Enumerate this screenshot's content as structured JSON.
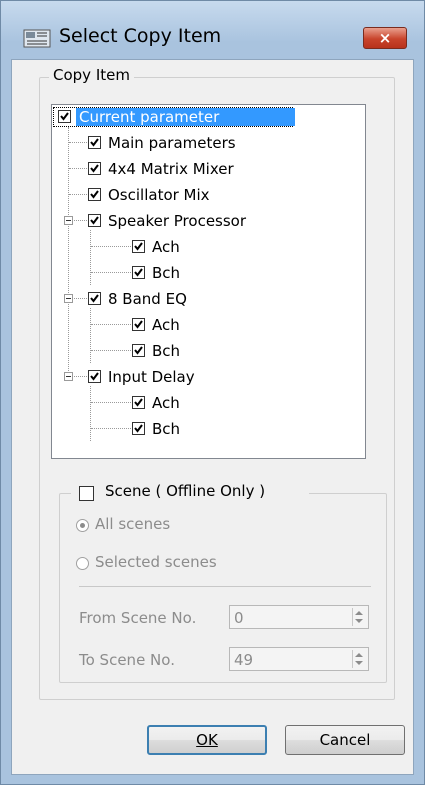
{
  "window": {
    "title": "Select Copy Item",
    "close_label": "×"
  },
  "copy_item_group": {
    "legend": "Copy Item"
  },
  "tree": {
    "root": {
      "label": "Current parameter",
      "checked": true
    },
    "nodes": [
      {
        "label": "Main parameters",
        "checked": true
      },
      {
        "label": "4x4 Matrix Mixer",
        "checked": true
      },
      {
        "label": "Oscillator Mix",
        "checked": true
      },
      {
        "label": "Speaker Processor",
        "checked": true
      },
      {
        "label": "Ach",
        "checked": true
      },
      {
        "label": "Bch",
        "checked": true
      },
      {
        "label": "8 Band EQ",
        "checked": true
      },
      {
        "label": "Ach",
        "checked": true
      },
      {
        "label": "Bch",
        "checked": true
      },
      {
        "label": "Input Delay",
        "checked": true
      },
      {
        "label": "Ach",
        "checked": true
      },
      {
        "label": "Bch",
        "checked": true
      }
    ]
  },
  "scene_group": {
    "checkbox_label": "Scene ( Offline Only )",
    "checked": false,
    "all_scenes_label": "All scenes",
    "selected_scenes_label": "Selected scenes",
    "from_label": "From Scene No.",
    "from_value": "0",
    "to_label": "To Scene No.",
    "to_value": "49"
  },
  "buttons": {
    "ok": "OK",
    "cancel": "Cancel"
  }
}
